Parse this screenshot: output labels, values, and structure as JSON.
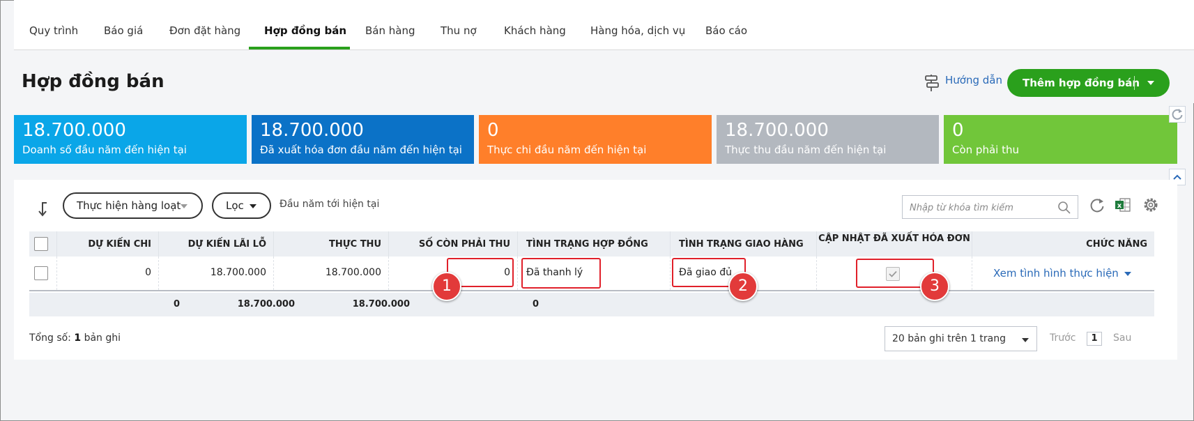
{
  "nav": {
    "tabs": [
      {
        "label": "Quy trình"
      },
      {
        "label": "Báo giá"
      },
      {
        "label": "Đơn đặt hàng"
      },
      {
        "label": "Hợp đồng bán",
        "active": true
      },
      {
        "label": "Bán hàng"
      },
      {
        "label": "Thu nợ"
      },
      {
        "label": "Khách hàng"
      },
      {
        "label": "Hàng hóa, dịch vụ"
      },
      {
        "label": "Báo cáo"
      }
    ]
  },
  "header": {
    "title": "Hợp đồng bán",
    "guide_label": "Hướng dẫn",
    "add_button_label": "Thêm hợp đồng bán"
  },
  "summary_cards": [
    {
      "value": "18.700.000",
      "label": "Doanh số đầu năm đến hiện tại",
      "color": "#0aa6e8"
    },
    {
      "value": "18.700.000",
      "label": "Đã xuất hóa đơn đầu năm đến hiện tại",
      "color": "#0b72c7"
    },
    {
      "value": "0",
      "label": "Thực chi đầu năm đến hiện tại",
      "color": "#ff7f2a"
    },
    {
      "value": "18.700.000",
      "label": "Thực thu đầu năm đến hiện tại",
      "color": "#b3b8bf"
    },
    {
      "value": "0",
      "label": "Còn phải thu",
      "color": "#71c63a"
    }
  ],
  "toolbar": {
    "bulk_action_label": "Thực hiện hàng loạt",
    "filter_label": "Lọc",
    "period_label": "Đầu năm tới hiện tại",
    "search_placeholder": "Nhập từ khóa tìm kiếm"
  },
  "table": {
    "columns": [
      "DỰ KIẾN CHI",
      "DỰ KIẾN LÃI LỖ",
      "THỰC THU",
      "SỐ CÒN PHẢI THU",
      "TÌNH TRẠNG HỢP ĐỒNG",
      "TÌNH TRẠNG GIAO HÀNG",
      "CẬP NHẬT ĐÃ XUẤT HÓA ĐƠN",
      "CHỨC NĂNG"
    ],
    "rows": [
      {
        "du_kien_chi": "0",
        "du_kien_lai_lo": "18.700.000",
        "thuc_thu": "18.700.000",
        "so_con_phai_thu": "0",
        "tinh_trang_hop_dong": "Đã thanh lý",
        "tinh_trang_giao_hang": "Đã giao đủ",
        "da_xuat_hoa_don": true,
        "action_label": "Xem tình hình thực hiện"
      }
    ],
    "totals": {
      "du_kien_chi": "0",
      "du_kien_lai_lo": "18.700.000",
      "thuc_thu": "18.700.000",
      "so_con_phai_thu": "0"
    }
  },
  "annotations": [
    "1",
    "2",
    "3"
  ],
  "footer": {
    "total_prefix": "Tổng số:",
    "total_count": "1",
    "total_suffix": "bản ghi",
    "page_size_label": "20 bản ghi trên 1 trang",
    "prev_label": "Trước",
    "current_page": "1",
    "next_label": "Sau"
  },
  "colors": {
    "accent_green": "#2aa01c",
    "link_blue": "#2a6ab8",
    "annotation_red": "#e0202a"
  }
}
